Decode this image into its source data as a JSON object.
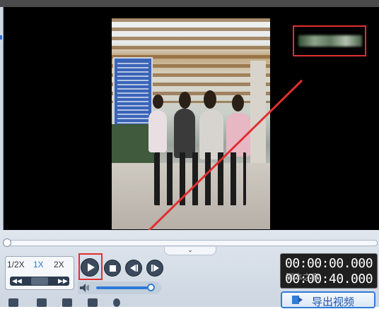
{
  "player": {
    "speeds": [
      "1/2X",
      "1X",
      "2X"
    ],
    "active_speed": "1X",
    "speed_slider": {
      "rewind_icon": "rewind-icon",
      "forward_icon": "fast-forward-icon"
    },
    "buttons": {
      "play": "play-icon",
      "stop": "stop-icon",
      "prev": "previous-frame-icon",
      "next": "next-frame-icon"
    },
    "time_current": "00:00:00.000",
    "time_total": "00:00:40.000",
    "volume_fraction": 0.95,
    "seek_fraction": 0.0
  },
  "watermark": {
    "text": "脚本之家"
  },
  "export": {
    "label": "导出视频",
    "icon": "export-icon"
  },
  "toolbar_icons": [
    "film-icon",
    "folder-icon",
    "save-icon",
    "crop-icon",
    "share-icon"
  ],
  "colors": {
    "accent": "#2f7bd8",
    "highlight": "#e03030",
    "dark": "#3c4a5e"
  }
}
